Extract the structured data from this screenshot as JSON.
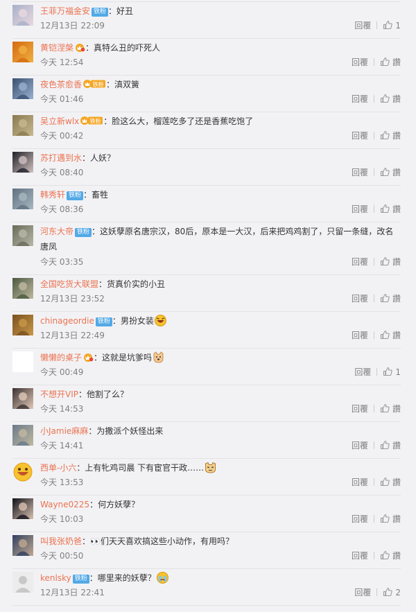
{
  "colors": {
    "username": "#eb7350",
    "badge": "#52a9e6",
    "meta": "#808080",
    "background": "#f2f2f5"
  },
  "comments": [
    {
      "user": "王菲万福金安",
      "badge": "铁粉",
      "vip": "none",
      "sep": "：",
      "text": "好丑",
      "text2": "",
      "emoji": "",
      "time": "12月13日 22:09",
      "reply": "回覆",
      "like": "1"
    },
    {
      "user": "黄铠涅槃",
      "badge": "",
      "vip": "crown",
      "sep": "：",
      "text": "真特么丑的吓死人",
      "text2": "",
      "emoji": "",
      "time": "今天 12:54",
      "reply": "回覆",
      "like": "讚"
    },
    {
      "user": "夜色茶愈香",
      "badge": "",
      "vip": "crown-fan",
      "sep": "：",
      "text": "滇双簧",
      "text2": "",
      "emoji": "",
      "time": "今天 01:46",
      "reply": "回覆",
      "like": "讚"
    },
    {
      "user": "吴立新wlx",
      "badge": "",
      "vip": "crown-fan",
      "sep": "：",
      "text": "脸这么大，榴莲吃多了还是香蕉吃饱了",
      "text2": "",
      "emoji": "",
      "time": "今天 00:42",
      "reply": "回覆",
      "like": "讚"
    },
    {
      "user": "苏打遇到水",
      "badge": "",
      "vip": "none",
      "sep": "：",
      "text": "人妖？",
      "text2": "",
      "emoji": "",
      "time": "今天 08:40",
      "reply": "回覆",
      "like": "讚"
    },
    {
      "user": "韩秀轩",
      "badge": "铁粉",
      "vip": "none",
      "sep": "：",
      "text": "畜牲",
      "text2": "",
      "emoji": "",
      "time": "今天 08:36",
      "reply": "回覆",
      "like": "讚"
    },
    {
      "user": "河东大帝",
      "badge": "铁粉",
      "vip": "none",
      "sep": "：",
      "text": "这妖孽原名唐宗汉，80后，原本是一大汉，后来把鸡鸡割了，只留一条缝，改名",
      "text2": "唐凤",
      "emoji": "",
      "time": "今天 03:35",
      "reply": "回覆",
      "like": "讚"
    },
    {
      "user": "全国吃货大联盟",
      "badge": "",
      "vip": "none",
      "sep": "：",
      "text": "货真价实的小丑",
      "text2": "",
      "emoji": "",
      "time": "12月13日 23:52",
      "reply": "回覆",
      "like": "讚"
    },
    {
      "user": "chinageordie",
      "badge": "铁粉",
      "vip": "none",
      "sep": "：",
      "text": "男扮女装",
      "text2": "",
      "emoji": "laugh",
      "time": "12月13日 22:49",
      "reply": "回覆",
      "like": "讚"
    },
    {
      "user": "懒懒的桌子",
      "badge": "",
      "vip": "crown",
      "sep": "：",
      "text": "这就是坑爹吗",
      "text2": "",
      "emoji": "doge",
      "time": "今天 00:49",
      "reply": "回覆",
      "like": "1"
    },
    {
      "user": "不想开VIP",
      "badge": "",
      "vip": "none",
      "sep": "：",
      "text": "他割了么？",
      "text2": "",
      "emoji": "",
      "time": "今天 14:53",
      "reply": "回覆",
      "like": "讚"
    },
    {
      "user": "小Jamie麻麻",
      "badge": "",
      "vip": "none",
      "sep": "：",
      "text": "为撒派个妖怪出来",
      "text2": "",
      "emoji": "",
      "time": "今天 14:41",
      "reply": "回覆",
      "like": "讚"
    },
    {
      "user": "西单-小六",
      "badge": "",
      "vip": "none",
      "sep": "：",
      "text": "上有牝鸡司晨 下有宦官干政……",
      "text2": "",
      "emoji": "cat",
      "time": "今天 13:53",
      "reply": "回覆",
      "like": "讚"
    },
    {
      "user": "Wayne0225",
      "badge": "",
      "vip": "none",
      "sep": "：",
      "text": "何方妖孽？",
      "text2": "",
      "emoji": "",
      "time": "今天 10:03",
      "reply": "回覆",
      "like": "讚"
    },
    {
      "user": "叫我张奶爸",
      "badge": "",
      "vip": "none",
      "sep": "：",
      "text": "👀们天天喜欢搞这些小动作，有用吗？",
      "text2": "",
      "emoji": "",
      "time": "今天 00:50",
      "reply": "回覆",
      "like": "讚"
    },
    {
      "user": "kenlsky",
      "badge": "铁粉",
      "vip": "none",
      "sep": "：",
      "text": "哪里来的妖孽？",
      "text2": "",
      "emoji": "cry",
      "time": "12月13日 22:41",
      "reply": "回覆",
      "like": "2"
    }
  ]
}
